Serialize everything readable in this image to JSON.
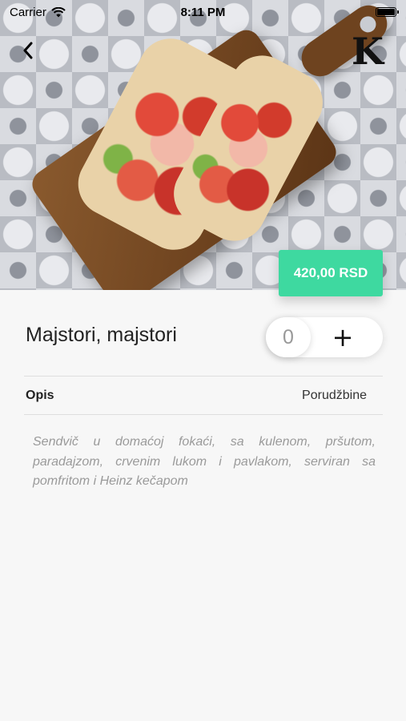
{
  "status_bar": {
    "carrier": "Carrier",
    "time": "8:11 PM"
  },
  "icons": {
    "back": "chevron-left-icon",
    "brand": "brand-logo",
    "wifi": "wifi-icon",
    "battery": "battery-icon"
  },
  "brand_logo_letter": "K",
  "product": {
    "price": "420,00 RSD",
    "name": "Majstori, majstori",
    "quantity": "0",
    "add_symbol": "+"
  },
  "tabs": {
    "description": "Opis",
    "orders": "Porudžbine"
  },
  "description_text": "Sendvič u domaćoj fokaći, sa kulenom, pršutom, paradajzom, crvenim lukom i pavlakom, serviran sa pomfritom i Heinz kečapom",
  "colors": {
    "accent": "#3ed9a0",
    "background": "#f7f7f7"
  }
}
